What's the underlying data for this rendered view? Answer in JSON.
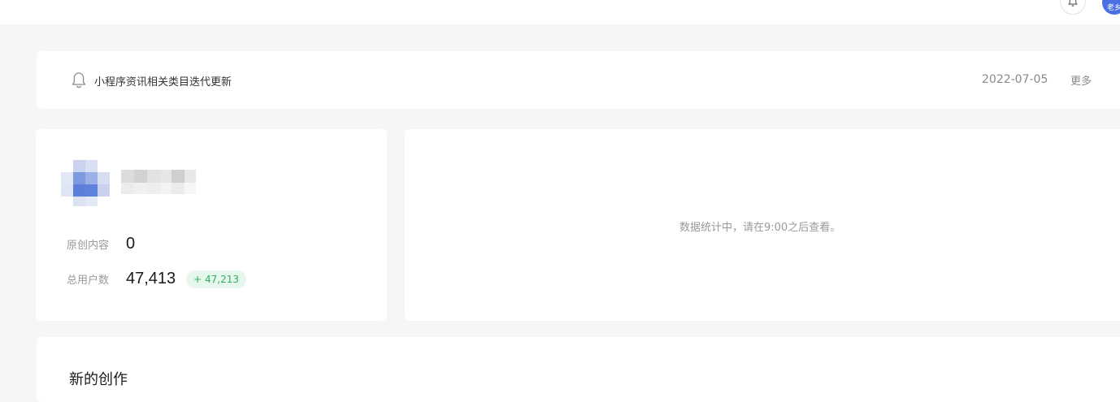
{
  "header": {
    "avatar_text": "老乡"
  },
  "notice": {
    "title": "小程序资讯相关类目迭代更新",
    "date": "2022-07-05",
    "more_label": "更多"
  },
  "profile": {
    "stats": [
      {
        "label": "原创内容",
        "value": "0"
      },
      {
        "label": "总用户数",
        "value": "47,413",
        "delta": "+ 47,213"
      }
    ]
  },
  "stats_panel": {
    "message": "数据统计中，请在9:00之后查看。"
  },
  "creation": {
    "heading": "新的创作"
  },
  "colors": {
    "accent": "#4a6fe3",
    "positive": "#2eaf5f",
    "positive_bg": "#e6f7ed",
    "page_bg": "#f5f6f8"
  }
}
